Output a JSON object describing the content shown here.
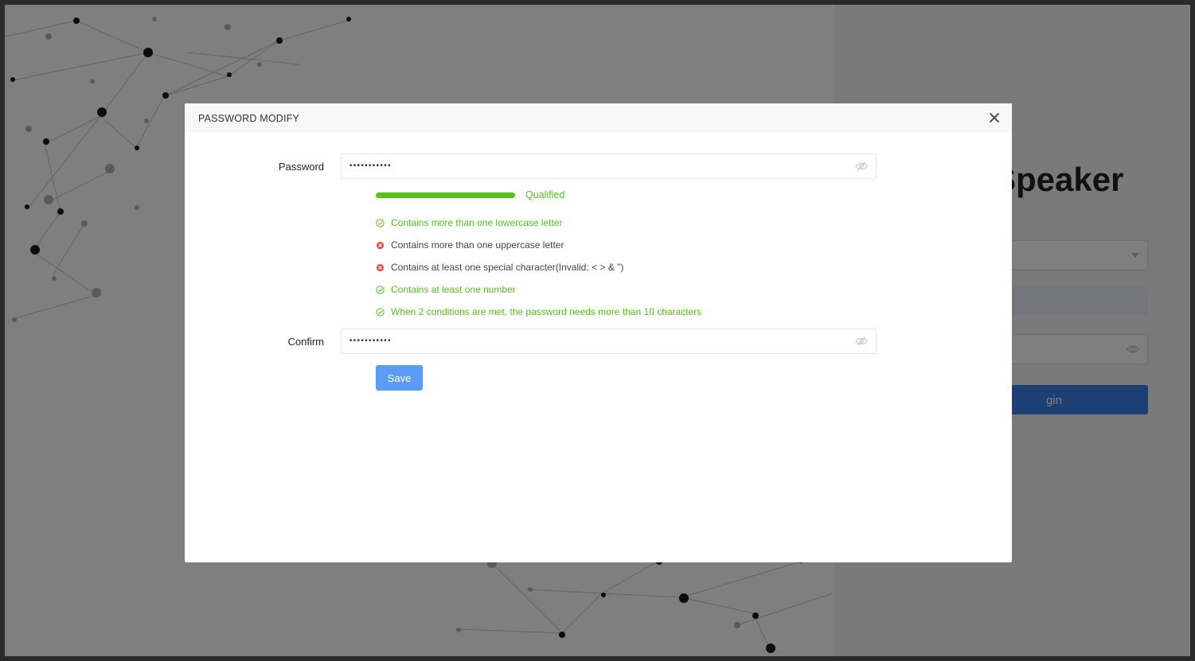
{
  "background": {
    "app_title": "Speaker",
    "login_button_label": "gin"
  },
  "modal": {
    "title": "PASSWORD MODIFY",
    "password_label": "Password",
    "password_value": "•••••••••••",
    "strength_label": "Qualified",
    "strength_level_percent": 100,
    "rules": [
      {
        "text": "Contains more than one lowercase letter",
        "met": true
      },
      {
        "text": "Contains more than one uppercase letter",
        "met": false
      },
      {
        "text": "Contains at least one special character(Invalid: < > & \")",
        "met": false
      },
      {
        "text": "Contains at least one number",
        "met": true
      },
      {
        "text": "When 2 conditions are met, the password needs more than 10 characters",
        "met": true
      }
    ],
    "confirm_label": "Confirm",
    "confirm_value": "•••••••••••",
    "save_label": "Save"
  },
  "colors": {
    "success": "#52c41a",
    "error": "#e8504a",
    "primary": "#5a9bf6"
  },
  "icons": {
    "close": "close-icon",
    "eye_off": "eye-off-icon",
    "rule_met": "check-circle-icon",
    "rule_unmet": "close-circle-icon"
  }
}
